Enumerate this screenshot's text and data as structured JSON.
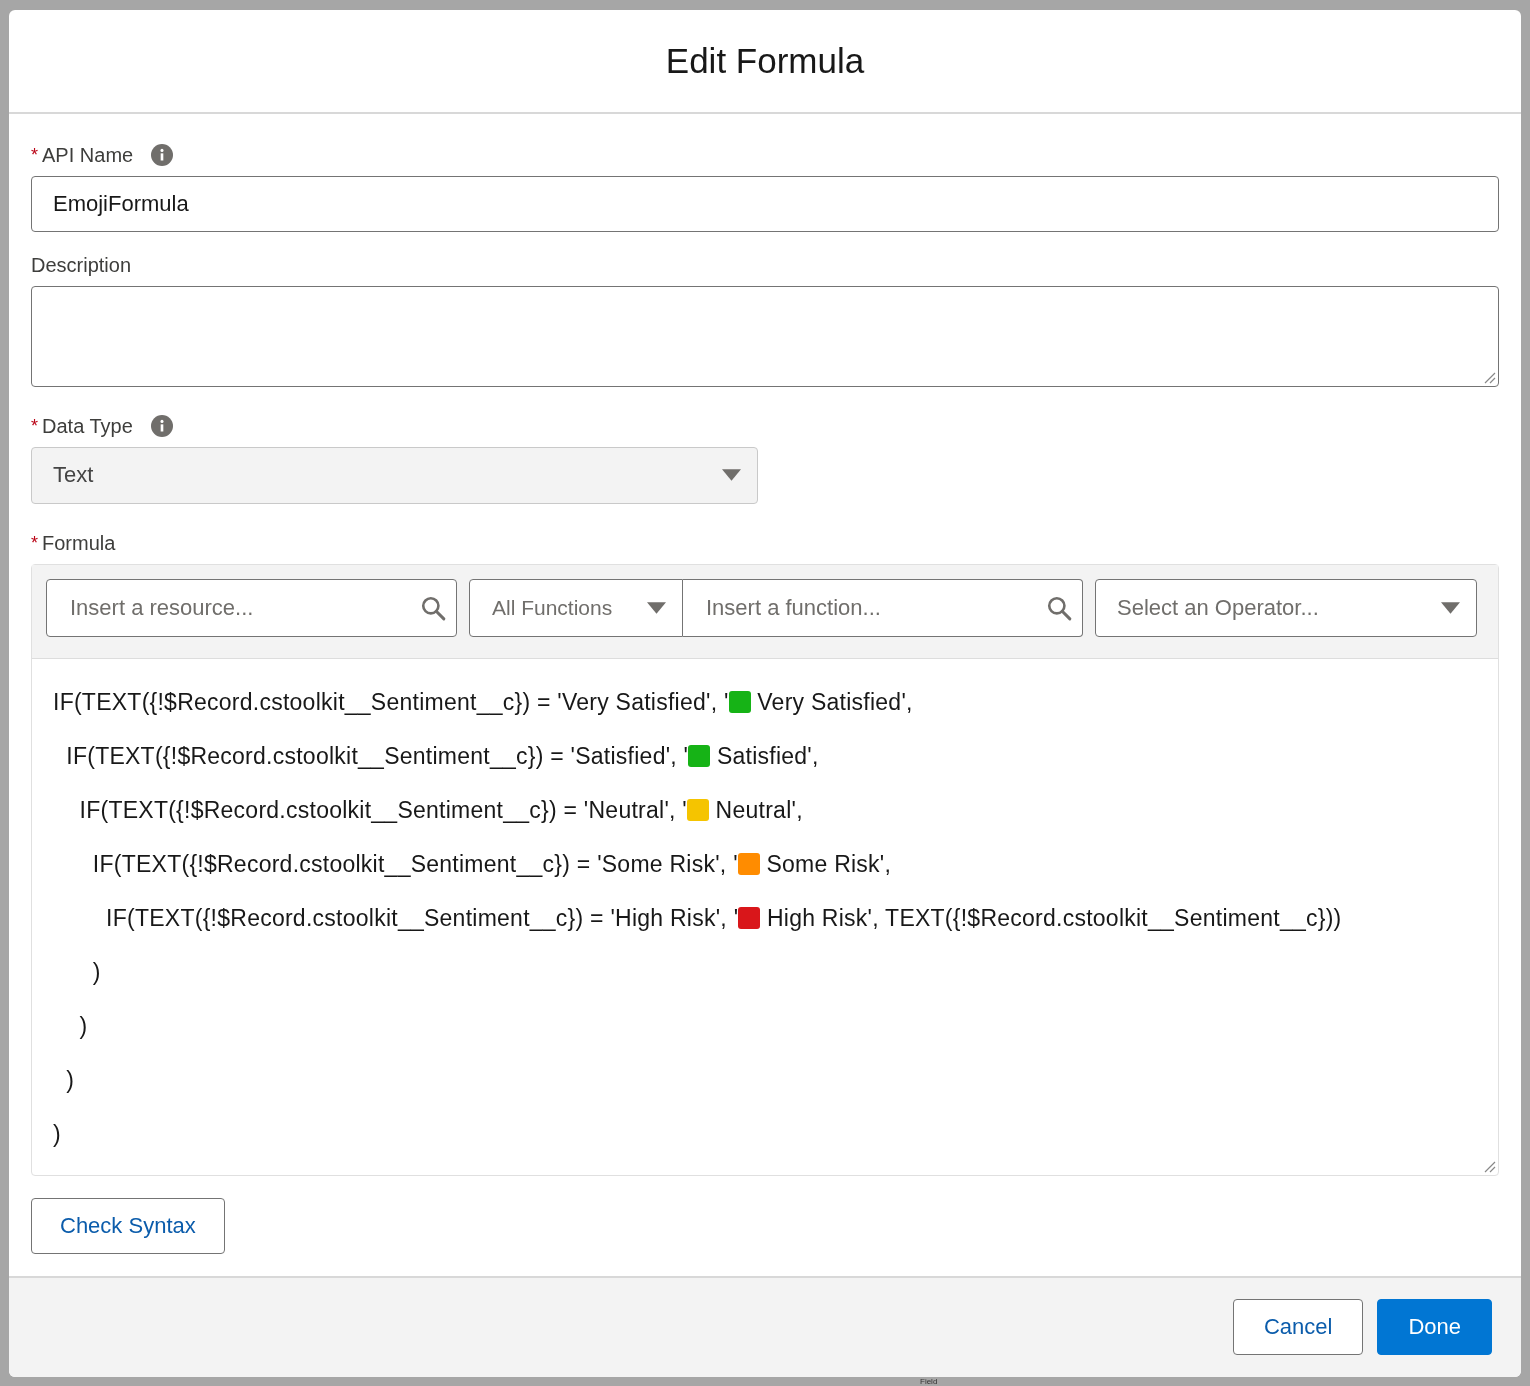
{
  "backdrop": {
    "text": "Field"
  },
  "dialog": {
    "title": "Edit Formula"
  },
  "api_name": {
    "label": "API Name",
    "required_mark": "*",
    "value": "EmojiFormula"
  },
  "description": {
    "label": "Description"
  },
  "data_type": {
    "label": "Data Type",
    "required_mark": "*",
    "value": "Text",
    "disabled": true
  },
  "formula": {
    "label": "Formula",
    "required_mark": "*",
    "resource_search": {
      "placeholder": "Insert a resource..."
    },
    "function_category": {
      "value": "All Functions"
    },
    "function_search": {
      "placeholder": "Insert a function..."
    },
    "operator_select": {
      "placeholder": "Select an Operator..."
    },
    "lines": [
      {
        "before": "IF(TEXT({!$Record.cstoolkit__Sentiment__c}) = 'Very Satisfied', '",
        "color": "#16b316",
        "after": " Very Satisfied',"
      },
      {
        "before": "  IF(TEXT({!$Record.cstoolkit__Sentiment__c}) = 'Satisfied', '",
        "color": "#16b316",
        "after": " Satisfied',"
      },
      {
        "before": "    IF(TEXT({!$Record.cstoolkit__Sentiment__c}) = 'Neutral', '",
        "color": "#f5c400",
        "after": " Neutral',"
      },
      {
        "before": "      IF(TEXT({!$Record.cstoolkit__Sentiment__c}) = 'Some Risk', '",
        "color": "#ff8c00",
        "after": " Some Risk',"
      },
      {
        "before": "        IF(TEXT({!$Record.cstoolkit__Sentiment__c}) = 'High Risk', '",
        "color": "#d9161a",
        "after": " High Risk', TEXT({!$Record.cstoolkit__Sentiment__c}))"
      },
      {
        "before": "      )"
      },
      {
        "before": "    )"
      },
      {
        "before": "  )"
      },
      {
        "before": ")"
      }
    ]
  },
  "check_button": "Check Syntax",
  "footer": {
    "buttons": [
      {
        "label": "Cancel",
        "kind": "neutral"
      },
      {
        "label": "Done",
        "kind": "brand"
      }
    ]
  }
}
